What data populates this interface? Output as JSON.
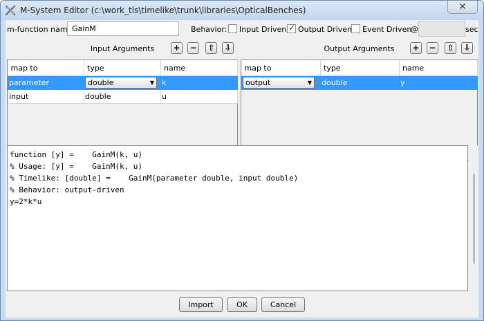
{
  "window": {
    "title": "M-System Editor   (c:\\work_tls\\timelike\\trunk\\libraries\\OpticalBenches)",
    "close_glyph": "✕"
  },
  "function": {
    "label": "m-function name:",
    "value": "GainM"
  },
  "behavior": {
    "label": "Behavior:",
    "options": [
      {
        "label": "Input Driven",
        "checked": false
      },
      {
        "label": "Output Driven",
        "checked": true
      },
      {
        "label": "Event Driven",
        "checked": false
      }
    ],
    "at_symbol": "@",
    "period_value": "",
    "unit": "sec"
  },
  "input_args": {
    "title": "Input Arguments",
    "columns": [
      "map to",
      "type",
      "name"
    ],
    "rows": [
      {
        "map_to": "parameter",
        "type": "double",
        "name": "k",
        "selected": true,
        "combo_col": "type"
      },
      {
        "map_to": "input",
        "type": "double",
        "name": "u",
        "selected": false
      }
    ]
  },
  "output_args": {
    "title": "Output Arguments",
    "columns": [
      "map to",
      "type",
      "name"
    ],
    "rows": [
      {
        "map_to": "output",
        "type": "double",
        "name": "y",
        "selected": true,
        "combo_col": "map_to"
      }
    ]
  },
  "toolbar_glyphs": {
    "add": "+",
    "remove": "−",
    "up": "⇧",
    "down": "⇩"
  },
  "code_lines": [
    "function [y] =    GainM(k, u)",
    "% Usage: [y] =    GainM(k, u)",
    "% Timelike: [double] =    GainM(parameter double, input double)",
    "% Behavior: output-driven",
    "y=2*k*u"
  ],
  "buttons": {
    "import": "Import",
    "ok": "OK",
    "cancel": "Cancel"
  }
}
